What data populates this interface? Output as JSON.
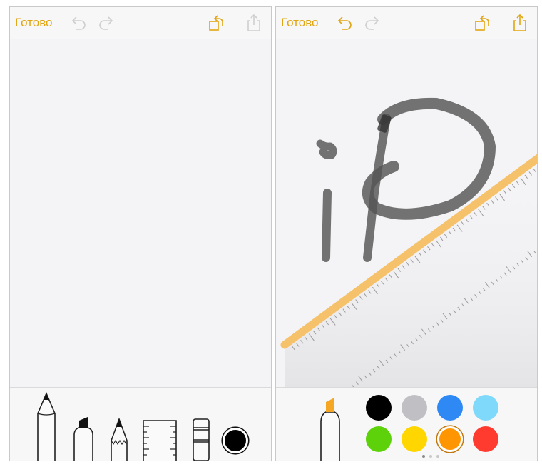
{
  "left_screen": {
    "done_label": "Готово",
    "undo_icon": "undo-arrow-icon",
    "redo_icon": "redo-arrow-icon",
    "rotate_icon": "rotate-square-icon",
    "share_icon": "share-icon",
    "tools": [
      "pen",
      "marker",
      "pencil",
      "ruler",
      "eraser",
      "color-picker"
    ],
    "selected_color": "#000000"
  },
  "right_screen": {
    "done_label": "Готово",
    "undo_icon": "undo-arrow-icon",
    "redo_icon": "redo-arrow-icon",
    "rotate_icon": "rotate-square-icon",
    "share_icon": "share-icon",
    "active_tool": "marker",
    "active_tool_color": "#f5a623",
    "palette": [
      "#000000",
      "#c0c0c4",
      "#2f89f5",
      "#7fd9fb",
      "#5dd20a",
      "#ffd600",
      "#ff9500",
      "#ff3b30"
    ],
    "selected_color": "#ff9500",
    "palette_pages": 3,
    "palette_page_active": 1
  },
  "colors": {
    "accent": "#e2a511",
    "ruler_edge": "#f5c26b",
    "ink": "#555555"
  }
}
